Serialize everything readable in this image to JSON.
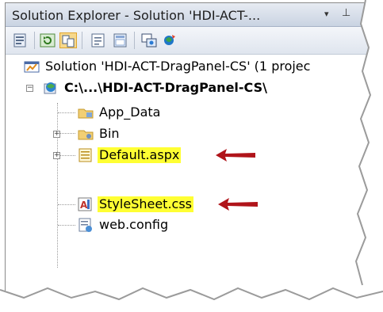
{
  "window": {
    "title": "Solution Explorer - Solution 'HDI-ACT-...",
    "dropdown_glyph": "▾",
    "pin_glyph": "⊥"
  },
  "toolbar": {
    "buttons": [
      {
        "name": "properties-icon"
      },
      {
        "name": "refresh-icon"
      },
      {
        "name": "show-all-files-icon"
      },
      {
        "name": "view-code-icon"
      },
      {
        "name": "view-designer-icon"
      },
      {
        "name": "copy-website-icon"
      },
      {
        "name": "asp-net-configuration-icon"
      }
    ]
  },
  "tree": {
    "solution": {
      "label": "Solution 'HDI-ACT-DragPanel-CS' (1 projec",
      "icon": "solution-icon"
    },
    "project": {
      "label": "C:\\...\\HDI-ACT-DragPanel-CS\\",
      "icon": "website-project-icon",
      "expander": "−"
    },
    "items": [
      {
        "label": "App_Data",
        "icon": "folder-icon",
        "expander": null,
        "highlight": false
      },
      {
        "label": "Bin",
        "icon": "folder-icon",
        "expander": "+",
        "highlight": false
      },
      {
        "label": "Default.aspx",
        "icon": "aspx-page-icon",
        "expander": "+",
        "highlight": true
      },
      {
        "label": "StyleSheet.css",
        "icon": "css-file-icon",
        "expander": null,
        "highlight": true
      },
      {
        "label": "web.config",
        "icon": "config-file-icon",
        "expander": null,
        "highlight": false
      }
    ]
  },
  "colors": {
    "highlight": "#ffff33",
    "annotation_arrow": "#b0141a",
    "titlebar": "#dbe2ec"
  }
}
